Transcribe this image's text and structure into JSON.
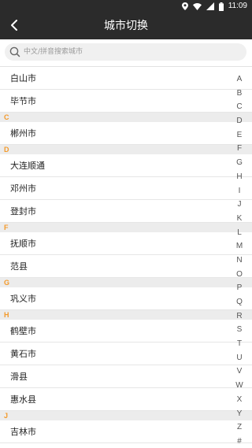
{
  "status_bar": {
    "time": "11:09",
    "icons": [
      "location-icon",
      "wifi-icon",
      "signal-icon",
      "battery-icon"
    ]
  },
  "header": {
    "title": "城市切换",
    "back_icon": "back-arrow-icon"
  },
  "search": {
    "placeholder": "中文/拼音搜索城市",
    "value": ""
  },
  "list": [
    {
      "type": "city",
      "name": "白山市"
    },
    {
      "type": "city",
      "name": "毕节市"
    },
    {
      "type": "section",
      "letter": "C"
    },
    {
      "type": "city",
      "name": "郴州市"
    },
    {
      "type": "section",
      "letter": "D"
    },
    {
      "type": "city",
      "name": "大连顺通"
    },
    {
      "type": "city",
      "name": "邓州市"
    },
    {
      "type": "city",
      "name": "登封市"
    },
    {
      "type": "section",
      "letter": "F"
    },
    {
      "type": "city",
      "name": "抚顺市"
    },
    {
      "type": "city",
      "name": "范县"
    },
    {
      "type": "section",
      "letter": "G"
    },
    {
      "type": "city",
      "name": "巩义市"
    },
    {
      "type": "section",
      "letter": "H"
    },
    {
      "type": "city",
      "name": "鹤壁市"
    },
    {
      "type": "city",
      "name": "黄石市"
    },
    {
      "type": "city",
      "name": "滑县"
    },
    {
      "type": "city",
      "name": "惠水县"
    },
    {
      "type": "section",
      "letter": "J"
    },
    {
      "type": "city",
      "name": "吉林市"
    }
  ],
  "alphabet_index": [
    "A",
    "B",
    "C",
    "D",
    "E",
    "F",
    "G",
    "H",
    "I",
    "J",
    "K",
    "L",
    "M",
    "N",
    "O",
    "P",
    "Q",
    "R",
    "S",
    "T",
    "U",
    "V",
    "W",
    "X",
    "Y",
    "Z",
    "#"
  ],
  "colors": {
    "header_bg": "#2b2b2b",
    "section_letter": "#f39a2b",
    "section_bg": "#ececec",
    "text": "#222222"
  }
}
